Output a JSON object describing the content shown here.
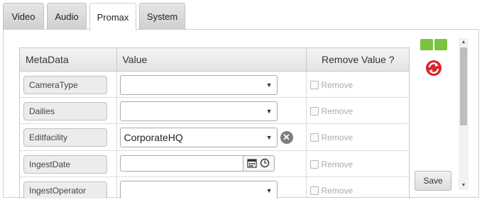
{
  "tabs": [
    {
      "label": "Video",
      "active": false
    },
    {
      "label": "Audio",
      "active": false
    },
    {
      "label": "Promax",
      "active": true
    },
    {
      "label": "System",
      "active": false
    }
  ],
  "table": {
    "headers": [
      "MetaData",
      "Value",
      "Remove Value ?"
    ],
    "rows": [
      {
        "meta": "CameraType",
        "type": "select",
        "value": "",
        "remove": "Remove"
      },
      {
        "meta": "Dailies",
        "type": "select",
        "value": "",
        "remove": "Remove"
      },
      {
        "meta": "Editfacility",
        "type": "select",
        "value": "CorporateHQ",
        "remove": "Remove"
      },
      {
        "meta": "IngestDate",
        "type": "date",
        "value": "",
        "remove": "Remove"
      },
      {
        "meta": "IngestOperator",
        "type": "select",
        "value": "",
        "remove": "Remove"
      }
    ]
  },
  "icons": {
    "select_arrow": "▼",
    "clear": "✕",
    "scroll_up": "▲",
    "scroll_down": "▼"
  },
  "actions": {
    "save_label": "Save"
  },
  "colors": {
    "green_button": "#7cc242",
    "refresh_red": "#d9262b"
  }
}
